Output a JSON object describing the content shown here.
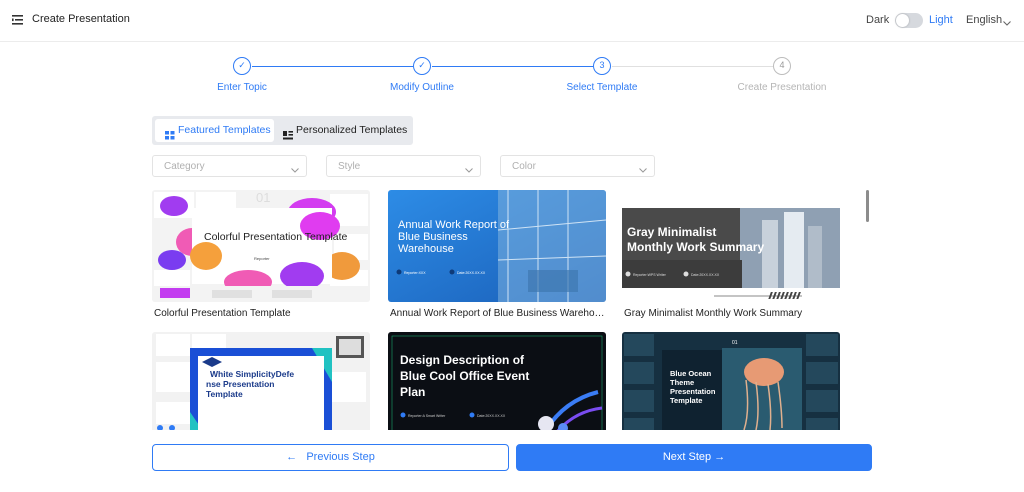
{
  "header": {
    "title": "Create Presentation",
    "theme_dark_label": "Dark",
    "theme_light_label": "Light",
    "language": "English"
  },
  "steps": [
    {
      "marker": "✓",
      "label": "Enter Topic",
      "state": "done"
    },
    {
      "marker": "✓",
      "label": "Modify Outline",
      "state": "done"
    },
    {
      "marker": "3",
      "label": "Select Template",
      "state": "current"
    },
    {
      "marker": "4",
      "label": "Create Presentation",
      "state": "pending"
    }
  ],
  "tabs": {
    "featured": "Featured Templates",
    "personalized": "Personalized Templates"
  },
  "filters": {
    "category": "Category",
    "style": "Style",
    "color": "Color"
  },
  "templates": [
    {
      "title": "Colorful Presentation Template",
      "thumb_heading": "Colorful Presentation Template",
      "thumb_caption": "Reporter",
      "thumb_number": "01"
    },
    {
      "title": "Annual Work Report of Blue Business Warehouse",
      "thumb_heading": "Annual Work Report of Blue Business Warehouse",
      "thumb_meta_1": "Reporter:XXX",
      "thumb_meta_2": "Date:20XX.XX.XX"
    },
    {
      "title": "Gray Minimalist Monthly Work Summary",
      "thumb_heading": "Gray Minimalist Monthly Work Summary",
      "thumb_meta_1": "Reporter:WPS Writer",
      "thumb_meta_2": "Date:20XX.XX.XX"
    },
    {
      "title": "White Simplicity Defense Presentation Template",
      "thumb_heading": "White SimplicityDefense Presentation Template"
    },
    {
      "title": "Design Description of Blue Cool Office Event Plan",
      "thumb_heading": "Design Description of Blue Cool Office Event Plan",
      "thumb_meta_1": "Reporter:A Smart Writer",
      "thumb_meta_2": "Date:20XX.XX.XX"
    },
    {
      "title": "Blue Ocean Theme Presentation Template",
      "thumb_heading": "Blue Ocean Theme Presentation Template",
      "thumb_number": "01"
    }
  ],
  "buttons": {
    "previous": "Previous Step",
    "next": "Next Step"
  },
  "colors": {
    "accent": "#2f7bf5",
    "inactive_step": "#bdbdbd"
  }
}
